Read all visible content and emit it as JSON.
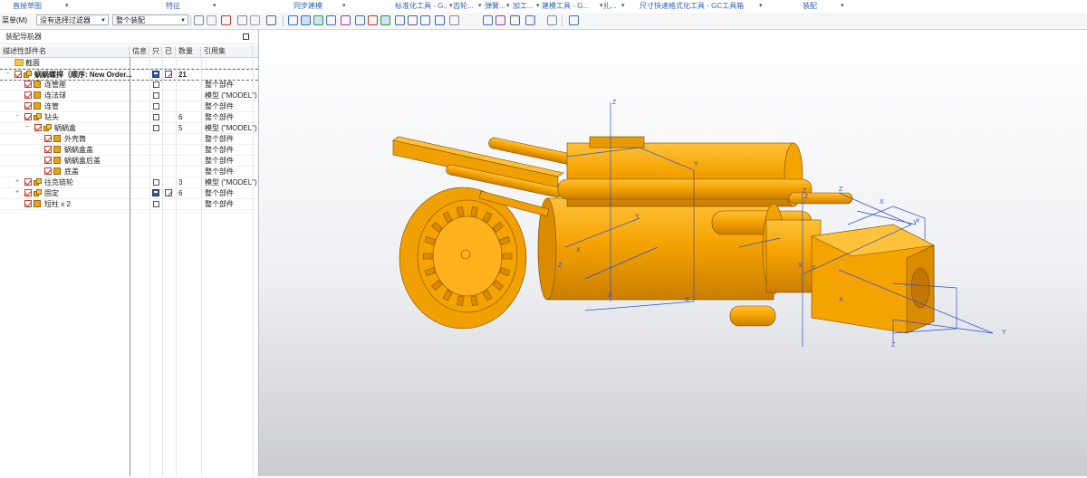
{
  "ribbon": {
    "groups": [
      "直接草图",
      "特征",
      "同步建模",
      "标准化工具 - G...",
      "齿轮...",
      "弹簧...",
      "加工...",
      "建模工具 - G...",
      "扎...",
      "尺寸快速格式化工具 - GC工具箱",
      "装配"
    ]
  },
  "toolbar": {
    "menu_label": "菜单(M)",
    "filter_value": "没有选择过滤器",
    "scope_value": "整个装配"
  },
  "navigator": {
    "title": "装配导航器",
    "columns": [
      "描述性部件名",
      "信息",
      "只",
      "已",
      "数量",
      "引用集"
    ],
    "rows": [
      {
        "label": "截面",
        "indent": 1,
        "icon": "folder",
        "check": false,
        "expand": "",
        "info": "",
        "only": "",
        "done": "",
        "qty": "",
        "ref": "",
        "bold": false
      },
      {
        "label": "蜗蜗螺捍（顺序: New Order...",
        "indent": 1,
        "icon": "assembly",
        "check": true,
        "expand": "−",
        "info": "",
        "only": "save",
        "done": "edit",
        "qty": "21",
        "ref": "",
        "bold": true,
        "selected": true
      },
      {
        "label": "连管座",
        "indent": 2,
        "icon": "part",
        "check": true,
        "expand": "",
        "info": "box",
        "only": "",
        "done": "",
        "qty": "",
        "ref": "整个部件",
        "bold": false
      },
      {
        "label": "连法球",
        "indent": 2,
        "icon": "part",
        "check": true,
        "expand": "",
        "info": "box",
        "only": "",
        "done": "",
        "qty": "",
        "ref": "模型 (\"MODEL\")",
        "bold": false
      },
      {
        "label": "连管",
        "indent": 2,
        "icon": "part",
        "check": true,
        "expand": "",
        "info": "box",
        "only": "",
        "done": "",
        "qty": "",
        "ref": "整个部件",
        "bold": false
      },
      {
        "label": "钻头",
        "indent": 2,
        "icon": "assembly",
        "check": true,
        "expand": "−",
        "info": "box",
        "only": "",
        "done": "",
        "qty": "6",
        "ref": "整个部件",
        "bold": false
      },
      {
        "label": "蜗蜗盒",
        "indent": 3,
        "icon": "assembly",
        "check": true,
        "expand": "−",
        "info": "box",
        "only": "",
        "done": "",
        "qty": "5",
        "ref": "模型 (\"MODEL\")",
        "bold": false
      },
      {
        "label": "外壳筒",
        "indent": 4,
        "icon": "part",
        "check": true,
        "expand": "",
        "info": "",
        "only": "",
        "done": "",
        "qty": "",
        "ref": "整个部件",
        "bold": false
      },
      {
        "label": "蜗蜗盒盖",
        "indent": 4,
        "icon": "part",
        "check": true,
        "expand": "",
        "info": "",
        "only": "",
        "done": "",
        "qty": "",
        "ref": "整个部件",
        "bold": false
      },
      {
        "label": "蜗蜗盒后盖",
        "indent": 4,
        "icon": "part",
        "check": true,
        "expand": "",
        "info": "",
        "only": "",
        "done": "",
        "qty": "",
        "ref": "整个部件",
        "bold": false
      },
      {
        "label": "底盖",
        "indent": 4,
        "icon": "part",
        "check": true,
        "expand": "",
        "info": "",
        "only": "",
        "done": "",
        "qty": "",
        "ref": "整个部件",
        "bold": false
      },
      {
        "label": "往克链轮",
        "indent": 2,
        "icon": "assembly",
        "check": true,
        "expand": "+",
        "info": "box",
        "only": "",
        "done": "",
        "qty": "3",
        "ref": "模型 (\"MODEL\")",
        "bold": false
      },
      {
        "label": "固定",
        "indent": 2,
        "icon": "assembly",
        "check": true,
        "expand": "+",
        "info": "",
        "only": "save",
        "done": "edit",
        "qty": "6",
        "ref": "整个部件",
        "bold": false
      },
      {
        "label": "短柱 x 2",
        "indent": 2,
        "icon": "part",
        "check": true,
        "expand": "",
        "info": "box",
        "only": "",
        "done": "",
        "qty": "",
        "ref": "整个部件",
        "bold": false
      }
    ]
  },
  "viewport": {
    "model_color": "#f5a300",
    "edge_color": "#2f4fd6",
    "axis_labels": [
      "Z",
      "X",
      "Y",
      "Z",
      "Y",
      "Z",
      "Y",
      "X",
      "Y",
      "X",
      "Y",
      "Z",
      "X",
      "Y",
      "Z",
      "X",
      "Z",
      "X"
    ]
  }
}
